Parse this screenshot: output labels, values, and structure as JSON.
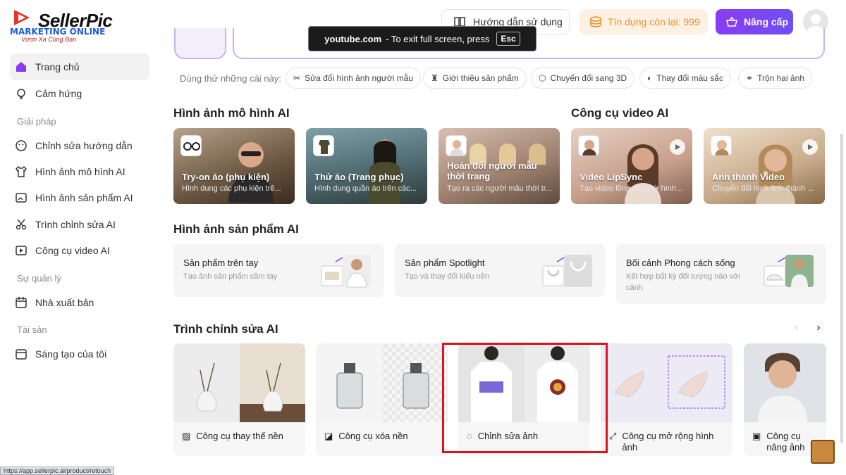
{
  "header": {
    "logo_text": "SellerPic",
    "logo_overlay_line1": "MARKETING ONLINE",
    "logo_overlay_line2": "Vươn Xa Cùng Bạn",
    "guide_label": "Hướng dẫn sử dụng",
    "credits_label": "Tín dụng còn lại: 999",
    "upgrade_label": "Nâng cấp"
  },
  "fullscreen_toast": {
    "domain": "youtube.com",
    "message": "-  To exit full screen, press",
    "key": "Esc"
  },
  "suggestions": {
    "label": "Dùng thử những cái này:",
    "chips": [
      "Sửa đổi hình ảnh người mẫu",
      "Giới thiệu sản phẩm",
      "Chuyển đổi sang 3D",
      "Thay đổi màu sắc",
      "Trộn hai ảnh"
    ]
  },
  "sidebar": {
    "home": "Trang chủ",
    "inspiration": "Cảm hứng",
    "section_solutions": "Giải pháp",
    "items_solutions": [
      "Chỉnh sửa hướng dẫn",
      "Hình ảnh mô hình AI",
      "Hình ảnh sản phẩm AI",
      "Trình chỉnh sửa AI",
      "Công cụ video AI"
    ],
    "section_management": "Sự quản lý",
    "publisher": "Nhà xuất bản",
    "section_assets": "Tài sản",
    "my_creations": "Sáng tạo của tôi"
  },
  "sections": {
    "model_images": "Hình ảnh mô hình AI",
    "video_tools": "Công cụ video AI",
    "product_images": "Hình ảnh sản phẩm AI",
    "ai_editor": "Trình chỉnh sửa AI"
  },
  "model_cards": [
    {
      "title": "Try-on áo (phụ kiện)",
      "subtitle": "Hình dung các phụ kiện trê..."
    },
    {
      "title": "Thử áo (Trang phục)",
      "subtitle": "Hình dung quần áo trên các..."
    },
    {
      "title": "Hoán đổi người mẫu thời trang",
      "subtitle": "Tạo ra các người mẫu thời tr..."
    }
  ],
  "video_cards": [
    {
      "title": "Video LipSync",
      "subtitle": "Tạo video lồng tiếng từ hình..."
    },
    {
      "title": "Ảnh thành Video",
      "subtitle": "Chuyển đổi hình ảnh thành ..."
    }
  ],
  "product_cards": [
    {
      "title": "Sản phẩm trên tay",
      "subtitle": "Tạo ảnh sản phẩm cầm tay"
    },
    {
      "title": "Sản phẩm Spotlight",
      "subtitle": "Tạo và thay đổi kiểu nền"
    },
    {
      "title": "Bối cảnh Phong cách sống",
      "subtitle": "Kết hợp bất kỳ đối tượng nào với cảnh"
    }
  ],
  "editor_cards": [
    {
      "label": "Công cụ thay thế nền"
    },
    {
      "label": "Công cụ xóa nền"
    },
    {
      "label": "Chỉnh sửa ảnh"
    },
    {
      "label": "Công cụ mở rộng hình ảnh"
    },
    {
      "label": "Công cụ nâng ảnh"
    }
  ],
  "status_url": "https://app.sellerpic.ai/product/retouch",
  "colors": {
    "accent": "#7b45f3",
    "credit": "#e3932f",
    "highlight": "#e0101c"
  }
}
